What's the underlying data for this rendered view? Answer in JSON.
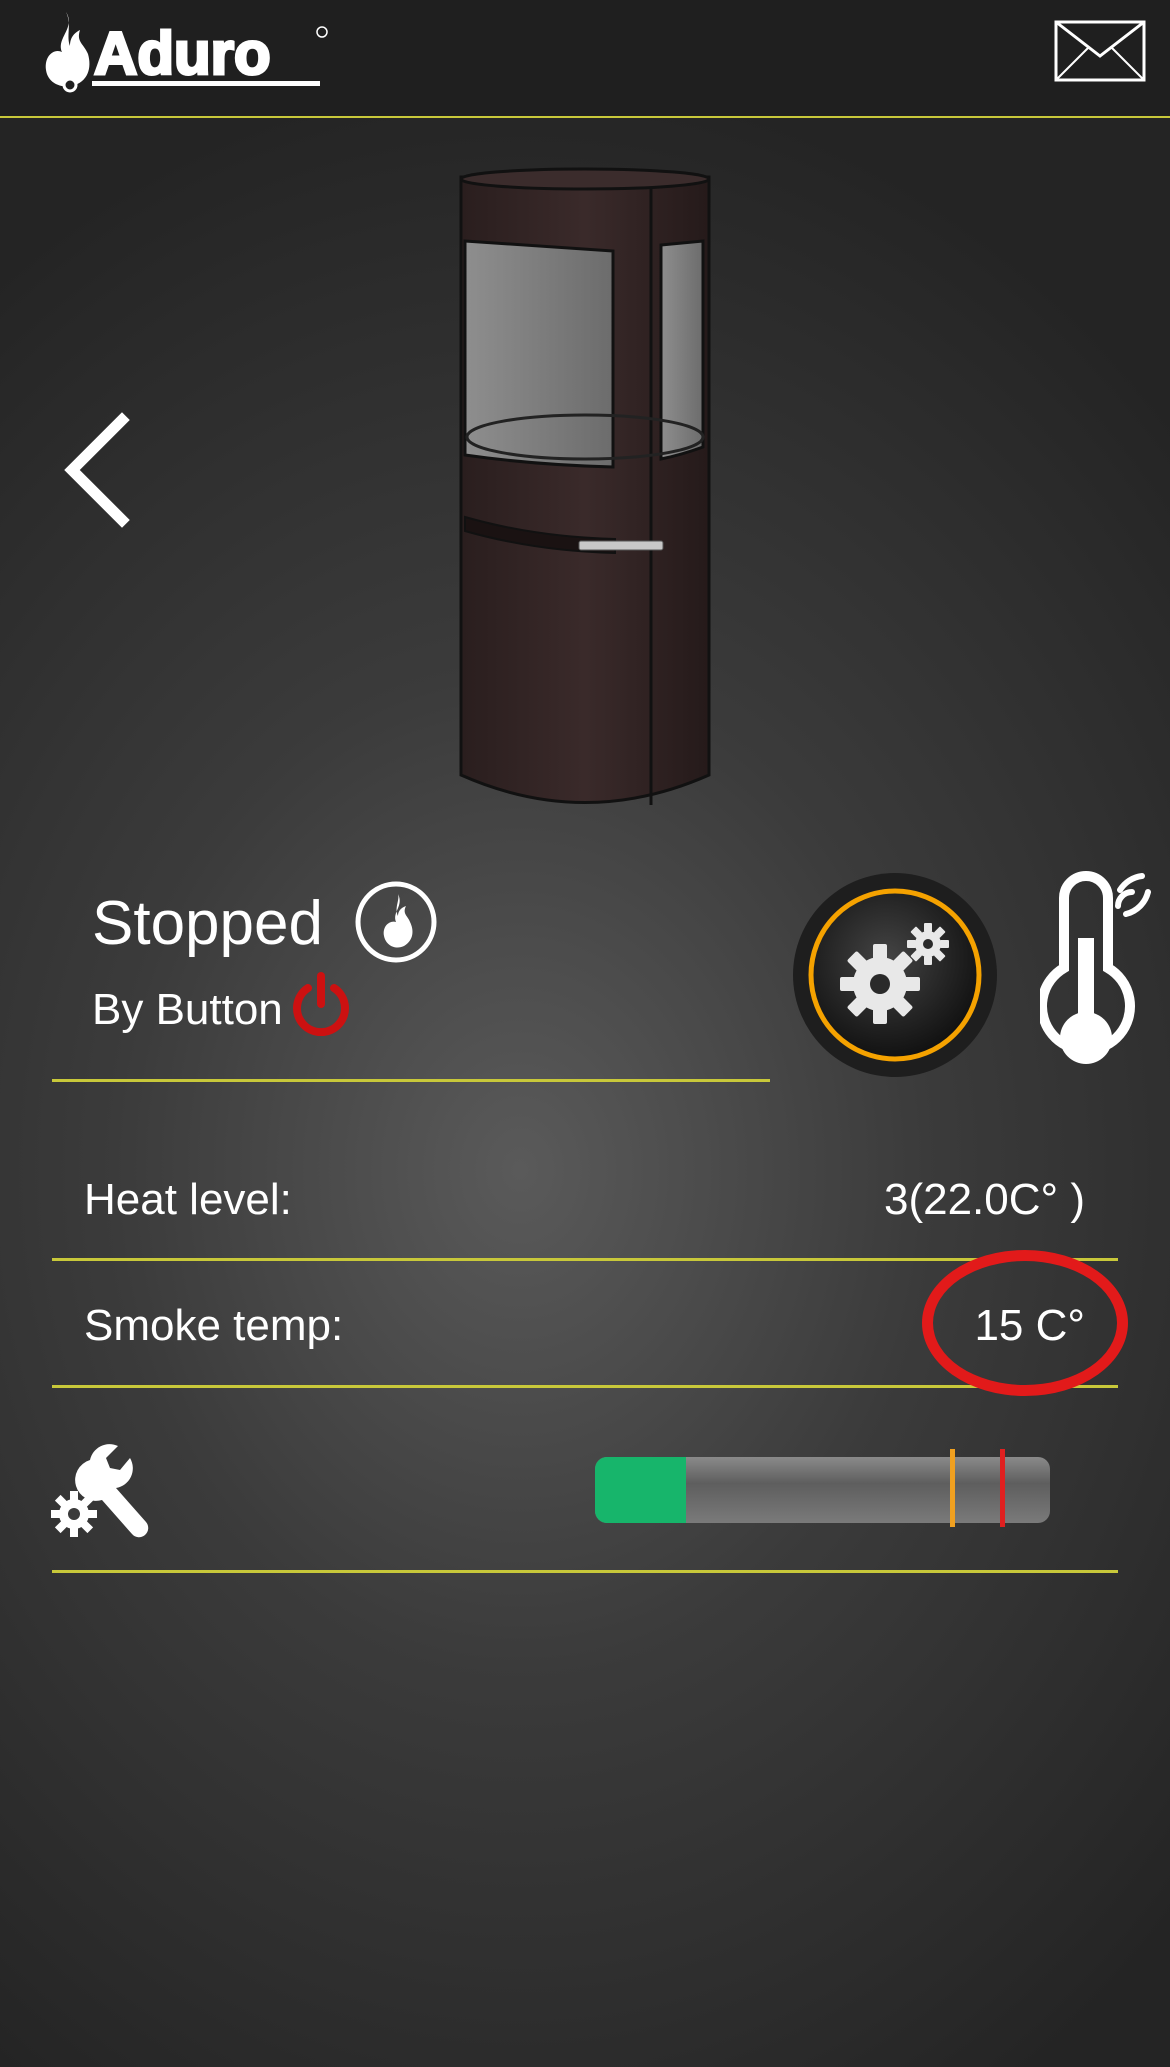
{
  "header": {
    "brand": "Aduro",
    "mail_icon": "mail-icon"
  },
  "status": {
    "title": "Stopped",
    "subtitle": "By Button",
    "flame_icon": "flame-icon",
    "power_icon": "power-icon",
    "power_color": "#cc1111"
  },
  "readings": [
    {
      "label": "Heat level:",
      "value": "3(22.0C° )"
    },
    {
      "label": "Smoke temp:",
      "value": "15 C°"
    }
  ],
  "smoke_bar": {
    "fill_fraction": 0.2,
    "fill_color": "#17b56b",
    "warning_marker_fraction": 0.78,
    "warning_color": "#f0a020",
    "limit_marker_fraction": 0.89,
    "limit_color": "#e02020"
  },
  "colors": {
    "accent_line": "#c8c83a",
    "gear_ring": "#f5a200",
    "highlight": "#e21a1a"
  }
}
